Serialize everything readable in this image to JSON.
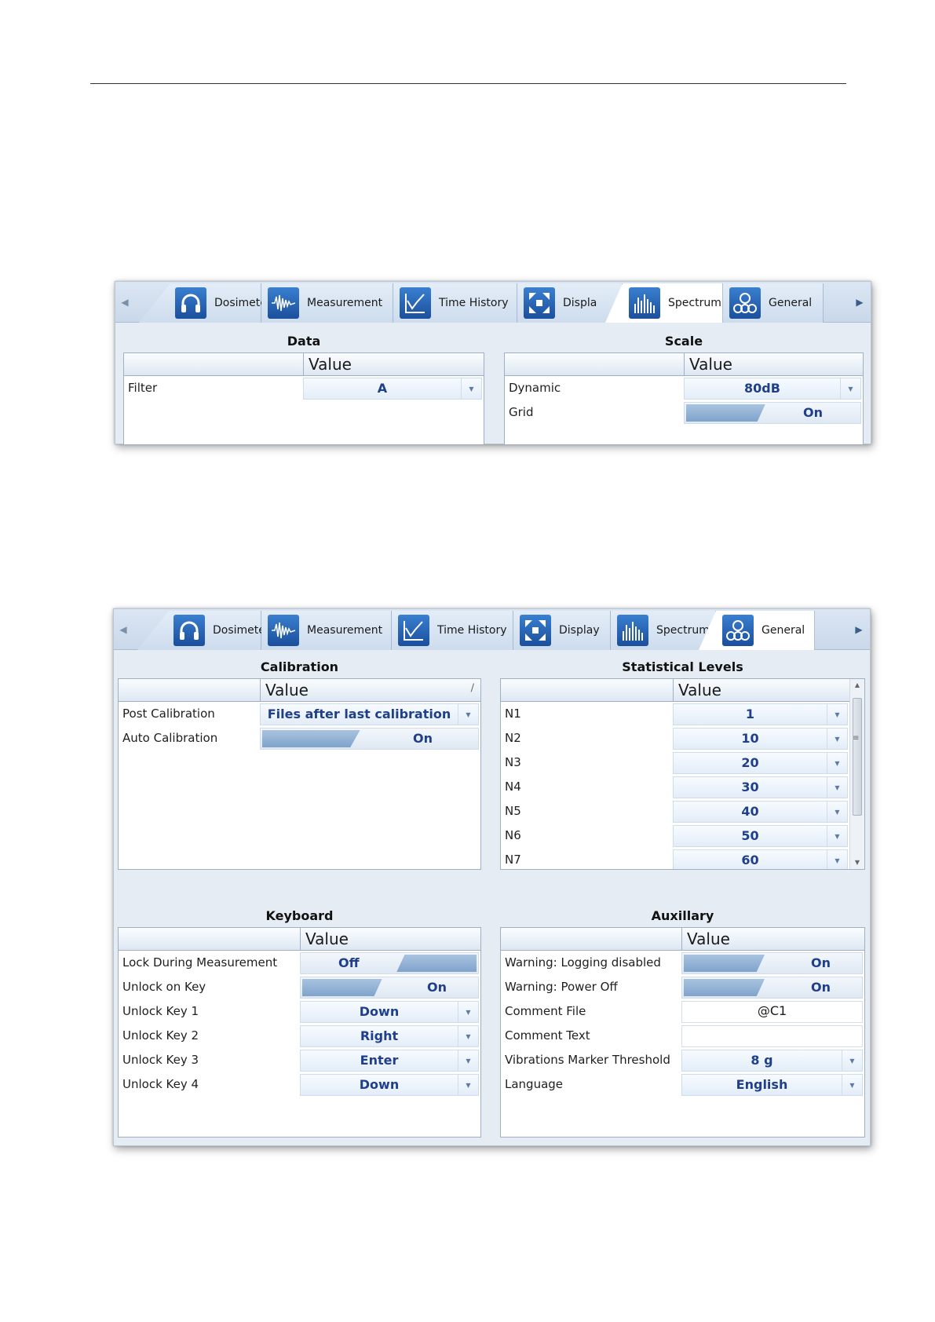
{
  "tabs": {
    "items": [
      "Dosimeter",
      "Measurement",
      "Time History",
      "Display",
      "Spectrum",
      "General"
    ],
    "window1_items": [
      "Dosimeter",
      "Measurement",
      "Time History",
      "Displa",
      "Spectrum",
      "General"
    ],
    "window2_items": [
      "Dosimeter",
      "Measurement",
      "Time History",
      "Display",
      "Spectrum",
      "General"
    ],
    "window1_active": "Spectrum",
    "window2_active": "General",
    "icons": [
      "headphones-icon",
      "waveform-icon",
      "line-chart-icon",
      "expand-arrows-icon",
      "bar-spectrum-icon",
      "gears-icon"
    ]
  },
  "value_header": "Value",
  "spectrum_window": {
    "data": {
      "title": "Data",
      "rows": [
        {
          "label": "Filter",
          "value": "A",
          "kind": "combo"
        }
      ]
    },
    "scale": {
      "title": "Scale",
      "rows": [
        {
          "label": "Dynamic",
          "value": "80dB",
          "kind": "combo"
        },
        {
          "label": "Grid",
          "value": "On",
          "kind": "toggle"
        }
      ]
    }
  },
  "general_window": {
    "calibration": {
      "title": "Calibration",
      "rows": [
        {
          "label": "Post Calibration",
          "value": "Files after last calibration",
          "kind": "combo"
        },
        {
          "label": "Auto Calibration",
          "value": "On",
          "kind": "toggle"
        }
      ]
    },
    "statistical_levels": {
      "title": "Statistical Levels",
      "rows": [
        {
          "label": "N1",
          "value": "1"
        },
        {
          "label": "N2",
          "value": "10"
        },
        {
          "label": "N3",
          "value": "20"
        },
        {
          "label": "N4",
          "value": "30"
        },
        {
          "label": "N5",
          "value": "40"
        },
        {
          "label": "N6",
          "value": "50"
        },
        {
          "label": "N7",
          "value": "60"
        }
      ]
    },
    "keyboard": {
      "title": "Keyboard",
      "rows": [
        {
          "label": "Lock During Measurement",
          "value": "Off",
          "kind": "toggle"
        },
        {
          "label": "Unlock on Key",
          "value": "On",
          "kind": "toggle"
        },
        {
          "label": "Unlock Key 1",
          "value": "Down",
          "kind": "combo"
        },
        {
          "label": "Unlock Key 2",
          "value": "Right",
          "kind": "combo"
        },
        {
          "label": "Unlock Key 3",
          "value": "Enter",
          "kind": "combo"
        },
        {
          "label": "Unlock Key 4",
          "value": "Down",
          "kind": "combo"
        }
      ]
    },
    "auxillary": {
      "title": "Auxillary",
      "rows": [
        {
          "label": "Warning: Logging disabled",
          "value": "On",
          "kind": "toggle"
        },
        {
          "label": "Warning: Power Off",
          "value": "On",
          "kind": "toggle"
        },
        {
          "label": "Comment File",
          "value": "@C1",
          "kind": "plain"
        },
        {
          "label": "Comment Text",
          "value": "",
          "kind": "plain"
        },
        {
          "label": "Vibrations Marker Threshold",
          "value": "8 g",
          "kind": "combo"
        },
        {
          "label": "Language",
          "value": "English",
          "kind": "combo"
        }
      ]
    }
  }
}
